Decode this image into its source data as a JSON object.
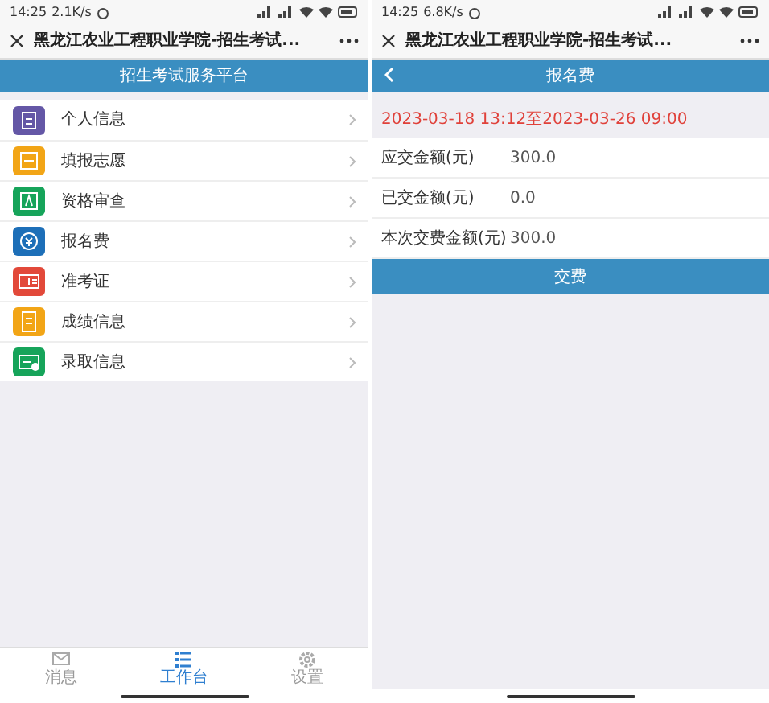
{
  "left": {
    "status_bar": {
      "time": "14:25",
      "speed": "2.1K/s"
    },
    "title_bar": {
      "title": "黑龙江农业工程职业学院-招生考试..."
    },
    "header": {
      "title": "招生考试服务平台"
    },
    "menu": [
      {
        "label": "个人信息",
        "color": "#6457a6",
        "kind": "profile"
      },
      {
        "label": "填报志愿",
        "color": "#f2a516",
        "kind": "form"
      },
      {
        "label": "资格审查",
        "color": "#16a45a",
        "kind": "review"
      },
      {
        "label": "报名费",
        "color": "#1d6fb8",
        "kind": "fee"
      },
      {
        "label": "准考证",
        "color": "#e2493a",
        "kind": "card"
      },
      {
        "label": "成绩信息",
        "color": "#f2a516",
        "kind": "score"
      },
      {
        "label": "录取信息",
        "color": "#16a45a",
        "kind": "admit"
      }
    ],
    "tab_bar": [
      {
        "label": "消息",
        "kind": "mail",
        "selected": false
      },
      {
        "label": "工作台",
        "kind": "list",
        "selected": true
      },
      {
        "label": "设置",
        "kind": "gear",
        "selected": false
      }
    ]
  },
  "right": {
    "status_bar": {
      "time": "14:25",
      "speed": "6.8K/s"
    },
    "title_bar": {
      "title": "黑龙江农业工程职业学院-招生考试..."
    },
    "header": {
      "title": "报名费"
    },
    "period": "2023-03-18 13:12至2023-03-26 09:00",
    "rows": [
      {
        "label": "应交金额(元)",
        "value": "300.0"
      },
      {
        "label": "已交金额(元)",
        "value": "0.0"
      },
      {
        "label": "本次交费金额(元)",
        "value": "300.0"
      }
    ],
    "pay_button": "交费"
  }
}
